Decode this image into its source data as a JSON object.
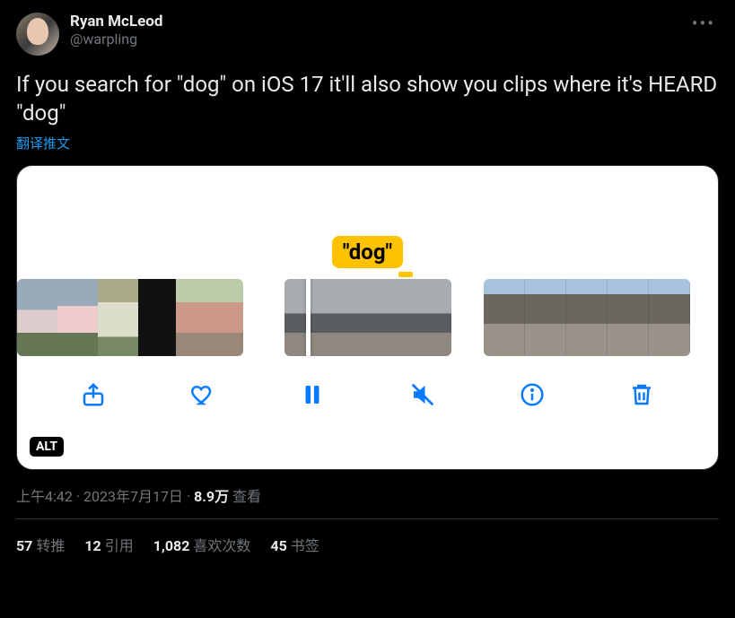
{
  "author": {
    "display_name": "Ryan McLeod",
    "handle": "@warpling"
  },
  "tweet_text": "If you search for \"dog\" on iOS 17 it'll also show you clips where it's HEARD \"dog\"",
  "translate_label": "翻译推文",
  "media": {
    "marker_text": "\"dog\"",
    "alt_badge": "ALT"
  },
  "timestamp": {
    "time": "上午4:42",
    "date": "2023年7月17日",
    "sep": " · ",
    "views_num": "8.9万",
    "views_label": " 查看"
  },
  "stats": {
    "retweets_num": "57",
    "retweets_label": "转推",
    "quotes_num": "12",
    "quotes_label": "引用",
    "likes_num": "1,082",
    "likes_label": "喜欢次数",
    "bookmarks_num": "45",
    "bookmarks_label": "书签"
  }
}
